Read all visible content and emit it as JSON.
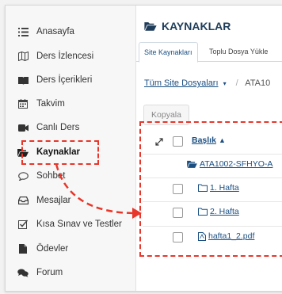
{
  "sidebar": {
    "items": [
      {
        "label": "Anasayfa",
        "icon": "list-icon"
      },
      {
        "label": "Ders İzlencesi",
        "icon": "map-icon"
      },
      {
        "label": "Ders İçerikleri",
        "icon": "book-icon"
      },
      {
        "label": "Takvim",
        "icon": "calendar-icon"
      },
      {
        "label": "Canlı Ders",
        "icon": "video-camera-icon"
      },
      {
        "label": "Kaynaklar",
        "icon": "folder-open-icon",
        "active": true
      },
      {
        "label": "Sohbet",
        "icon": "chat-icon"
      },
      {
        "label": "Mesajlar",
        "icon": "inbox-icon"
      },
      {
        "label": "Kısa Sınav ve Testler",
        "icon": "checkbox-icon"
      },
      {
        "label": "Ödevler",
        "icon": "document-icon"
      },
      {
        "label": "Forum",
        "icon": "comments-icon"
      }
    ]
  },
  "main": {
    "title": "KAYNAKLAR",
    "tabs": [
      "Site Kaynakları",
      "Toplu Dosya Yükle"
    ],
    "breadcrumb": {
      "link": "Tüm Site Dosyaları",
      "separator": "/",
      "current": "ATA10"
    },
    "copy_button": "Kopyala",
    "table": {
      "header": "Başlık",
      "rows": [
        {
          "name": "ATA1002-SFHYO-A",
          "type": "folder-open-icon"
        },
        {
          "name": "1. Hafta",
          "type": "folder-icon"
        },
        {
          "name": "2. Hafta",
          "type": "folder-icon"
        },
        {
          "name": "hafta1_2.pdf",
          "type": "pdf-file-icon"
        }
      ]
    }
  },
  "colors": {
    "accent": "#e8362a",
    "link": "#1b4f82",
    "title": "#1f3d5a"
  }
}
